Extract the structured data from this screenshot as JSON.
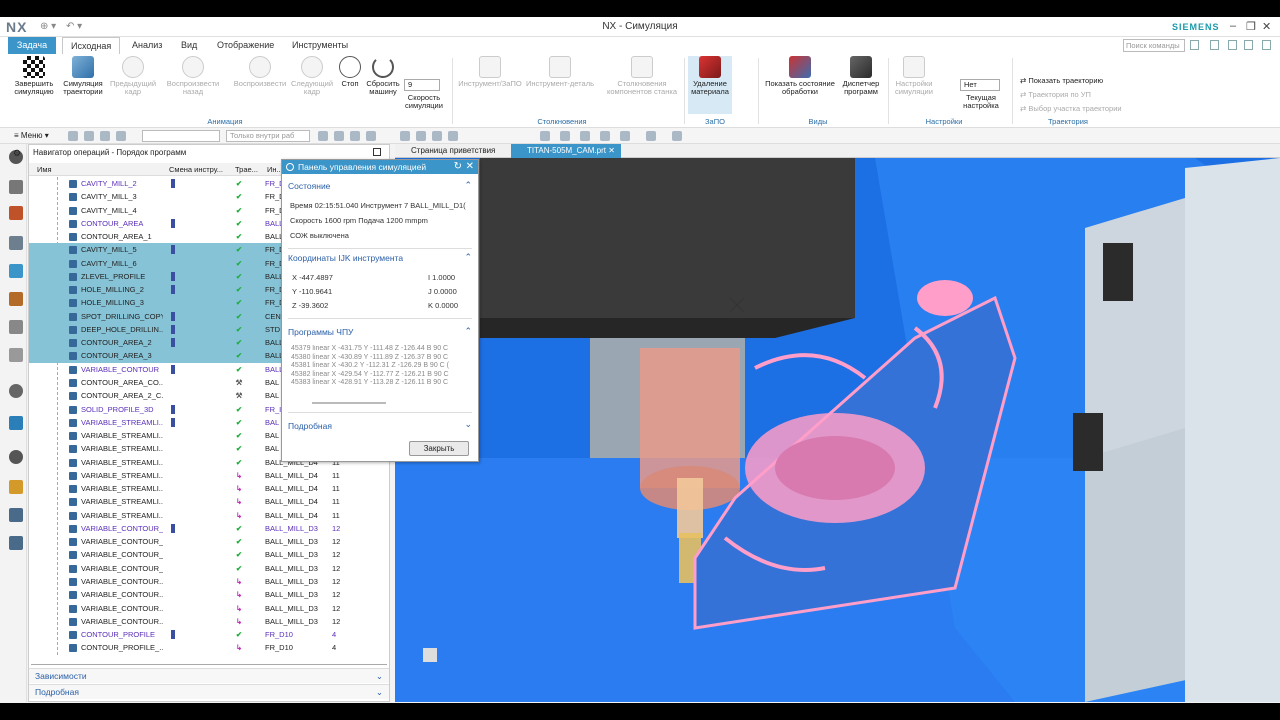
{
  "app": {
    "logo": "NX",
    "window_title": "NX - Симуляция",
    "brand": "SIEMENS"
  },
  "tabs": {
    "task": "Задача",
    "items": [
      "Исходная",
      "Анализ",
      "Вид",
      "Отображение",
      "Инструменты"
    ],
    "active": "Исходная",
    "search_placeholder": "Поиск команды"
  },
  "ribbon": {
    "finish": "Завершить симуляцию",
    "sim_path": "Симуляция траектории",
    "prev_frame": "Предыдущий кадр",
    "play_back": "Воспроизвести назад",
    "play": "Воспроизвести",
    "next_frame": "Следующий кадр",
    "stop": "Стоп",
    "reset": "Сбросить машину",
    "speed_label": "Скорость симуляции",
    "speed_value": "9",
    "group_animation": "Анимация",
    "tool_fixture": "Инструмент/ЗаПО",
    "tool_part": "Инструмент-деталь",
    "collisions": "Столкновения компонентов станка",
    "group_collisions": "Столкновения",
    "remove_material": "Удаление материала",
    "group_ipw": "ЗаПО",
    "show_state": "Показать состояние обработки",
    "dispatcher": "Диспетчер программ",
    "group_views": "Виды",
    "sim_settings": "Настройки симуляции",
    "no_value": "Нет",
    "current_settings": "Текущая настройка",
    "group_settings": "Настройки",
    "show_path": "Показать траекторию",
    "path_by_ucs": "Траектория по УП",
    "select_path_segment": "Выбор участка траектории",
    "group_path": "Траектория"
  },
  "toolbar": {
    "menu": "Меню",
    "filter": "Только внутри раб"
  },
  "navigator": {
    "title": "Навигатор операций - Порядок программ",
    "columns": [
      "Имя",
      "Смена инстру...",
      "Трае...",
      "Ин..."
    ],
    "rows": [
      {
        "name": "CAVITY_MILL_2",
        "tool": "FR_D",
        "n": "",
        "status": "ok",
        "sel": false,
        "purple": true,
        "toolchange": true
      },
      {
        "name": "CAVITY_MILL_3",
        "tool": "FR_D",
        "n": "",
        "status": "ok",
        "sel": false,
        "purple": false,
        "toolchange": false
      },
      {
        "name": "CAVITY_MILL_4",
        "tool": "FR_D",
        "n": "",
        "status": "ok",
        "sel": false,
        "purple": false,
        "toolchange": false
      },
      {
        "name": "CONTOUR_AREA",
        "tool": "BALL",
        "n": "",
        "status": "ok",
        "sel": false,
        "purple": true,
        "toolchange": true
      },
      {
        "name": "CONTOUR_AREA_1",
        "tool": "BALL",
        "n": "",
        "status": "ok",
        "sel": false,
        "purple": false,
        "toolchange": false
      },
      {
        "name": "CAVITY_MILL_5",
        "tool": "FR_D",
        "n": "",
        "status": "ok",
        "sel": true,
        "purple": false,
        "toolchange": true
      },
      {
        "name": "CAVITY_MILL_6",
        "tool": "FR_D",
        "n": "",
        "status": "ok",
        "sel": true,
        "purple": false,
        "toolchange": false
      },
      {
        "name": "ZLEVEL_PROFILE",
        "tool": "BALL",
        "n": "",
        "status": "ok",
        "sel": true,
        "purple": false,
        "toolchange": true
      },
      {
        "name": "HOLE_MILLING_2",
        "tool": "FR_D",
        "n": "",
        "status": "ok",
        "sel": true,
        "purple": false,
        "toolchange": true
      },
      {
        "name": "HOLE_MILLING_3",
        "tool": "FR_D",
        "n": "",
        "status": "ok",
        "sel": true,
        "purple": false,
        "toolchange": false
      },
      {
        "name": "SPOT_DRILLING_COPY",
        "tool": "CEN",
        "n": "",
        "status": "ok",
        "sel": true,
        "purple": false,
        "toolchange": true
      },
      {
        "name": "DEEP_HOLE_DRILLIN...",
        "tool": "STD",
        "n": "",
        "status": "ok",
        "sel": true,
        "purple": false,
        "toolchange": true
      },
      {
        "name": "CONTOUR_AREA_2",
        "tool": "BALL",
        "n": "",
        "status": "ok",
        "sel": true,
        "purple": false,
        "toolchange": true
      },
      {
        "name": "CONTOUR_AREA_3",
        "tool": "BALL",
        "n": "",
        "status": "ok",
        "sel": true,
        "purple": false,
        "toolchange": false
      },
      {
        "name": "VARIABLE_CONTOUR",
        "tool": "BALL",
        "n": "",
        "status": "ok",
        "sel": false,
        "purple": true,
        "toolchange": true
      },
      {
        "name": "CONTOUR_AREA_CO...",
        "tool": "BAL",
        "n": "",
        "status": "wr",
        "sel": false,
        "purple": false,
        "toolchange": false
      },
      {
        "name": "CONTOUR_AREA_2_C...",
        "tool": "BAL",
        "n": "",
        "status": "wr",
        "sel": false,
        "purple": false,
        "toolchange": false
      },
      {
        "name": "SOLID_PROFILE_3D",
        "tool": "FR_I",
        "n": "",
        "status": "ok",
        "sel": false,
        "purple": true,
        "toolchange": true
      },
      {
        "name": "VARIABLE_STREAMLI...",
        "tool": "BAL",
        "n": "",
        "status": "ok",
        "sel": false,
        "purple": true,
        "toolchange": true
      },
      {
        "name": "VARIABLE_STREAMLI...",
        "tool": "BAL",
        "n": "",
        "status": "ok",
        "sel": false,
        "purple": false,
        "toolchange": false
      },
      {
        "name": "VARIABLE_STREAMLI...",
        "tool": "BAL",
        "n": "",
        "status": "ok",
        "sel": false,
        "purple": false,
        "toolchange": false
      },
      {
        "name": "VARIABLE_STREAMLI...",
        "tool": "BALL_MILL_D4",
        "n": "11",
        "status": "ok",
        "sel": false,
        "purple": false,
        "toolchange": false
      },
      {
        "name": "VARIABLE_STREAMLI...",
        "tool": "BALL_MILL_D4",
        "n": "11",
        "status": "mv",
        "sel": false,
        "purple": false,
        "toolchange": false
      },
      {
        "name": "VARIABLE_STREAMLI...",
        "tool": "BALL_MILL_D4",
        "n": "11",
        "status": "mv",
        "sel": false,
        "purple": false,
        "toolchange": false
      },
      {
        "name": "VARIABLE_STREAMLI...",
        "tool": "BALL_MILL_D4",
        "n": "11",
        "status": "mv",
        "sel": false,
        "purple": false,
        "toolchange": false
      },
      {
        "name": "VARIABLE_STREAMLI...",
        "tool": "BALL_MILL_D4",
        "n": "11",
        "status": "mv",
        "sel": false,
        "purple": false,
        "toolchange": false
      },
      {
        "name": "VARIABLE_CONTOUR_1",
        "tool": "BALL_MILL_D3",
        "n": "12",
        "status": "ok",
        "sel": false,
        "purple": true,
        "toolchange": true
      },
      {
        "name": "VARIABLE_CONTOUR_2",
        "tool": "BALL_MILL_D3",
        "n": "12",
        "status": "ok",
        "sel": false,
        "purple": false,
        "toolchange": false
      },
      {
        "name": "VARIABLE_CONTOUR_3",
        "tool": "BALL_MILL_D3",
        "n": "12",
        "status": "ok",
        "sel": false,
        "purple": false,
        "toolchange": false
      },
      {
        "name": "VARIABLE_CONTOUR_4",
        "tool": "BALL_MILL_D3",
        "n": "12",
        "status": "ok",
        "sel": false,
        "purple": false,
        "toolchange": false
      },
      {
        "name": "VARIABLE_CONTOUR...",
        "tool": "BALL_MILL_D3",
        "n": "12",
        "status": "mv",
        "sel": false,
        "purple": false,
        "toolchange": false
      },
      {
        "name": "VARIABLE_CONTOUR...",
        "tool": "BALL_MILL_D3",
        "n": "12",
        "status": "mv",
        "sel": false,
        "purple": false,
        "toolchange": false
      },
      {
        "name": "VARIABLE_CONTOUR...",
        "tool": "BALL_MILL_D3",
        "n": "12",
        "status": "mv",
        "sel": false,
        "purple": false,
        "toolchange": false
      },
      {
        "name": "VARIABLE_CONTOUR...",
        "tool": "BALL_MILL_D3",
        "n": "12",
        "status": "mv",
        "sel": false,
        "purple": false,
        "toolchange": false
      },
      {
        "name": "CONTOUR_PROFILE",
        "tool": "FR_D10",
        "n": "4",
        "status": "ok",
        "sel": false,
        "purple": true,
        "toolchange": true
      },
      {
        "name": "CONTOUR_PROFILE_...",
        "tool": "FR_D10",
        "n": "4",
        "status": "mv",
        "sel": false,
        "purple": false,
        "toolchange": false
      }
    ],
    "dependencies": "Зависимости",
    "details": "Подробная"
  },
  "doc_tabs": {
    "welcome": "Страница приветствия",
    "file": "TITAN-505M_CAM.prt"
  },
  "sim_panel": {
    "title": "Панель управления симуляцией",
    "state_header": "Состояние",
    "time_line": "Время 02:15:51.040  Инструмент 7   BALL_MILL_D1(",
    "speed_line": "Скорость 1600 rpm Подача 1200 mmpm",
    "coolant_line": "СОЖ выключена",
    "coords_header": "Координаты IJK инструмента",
    "x": "X -447.4897",
    "y": "Y -110.9641",
    "z": "Z -39.3602",
    "i": "I 1.0000",
    "j": "J 0.0000",
    "k": "K 0.0000",
    "nc_header": "Программы ЧПУ",
    "nc_lines": [
      "45379 linear X -431.75 Y -111.48 Z -126.44 B 90 C",
      "45380 linear X -430.89 Y -111.89 Z -126.37 B 90 C",
      "45381 linear X -430.2 Y -112.31 Z -126.29 B 90 C (",
      "45382 linear X -429.54 Y -112.77 Z -126.21 B 90 C",
      "45383 linear X -428.91 Y -113.28 Z -126.11 B 90 C"
    ],
    "details_header": "Подробная",
    "close": "Закрыть"
  }
}
